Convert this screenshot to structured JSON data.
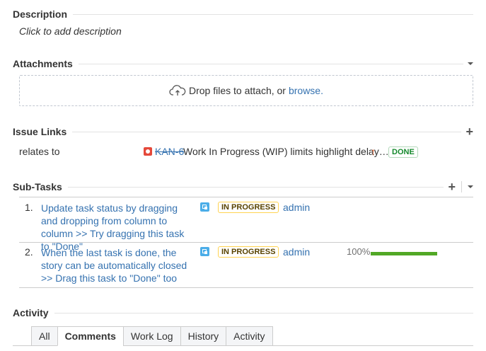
{
  "description": {
    "title": "Description",
    "placeholder": "Click to add description"
  },
  "attachments": {
    "title": "Attachments",
    "drop_text": "Drop files to attach, or",
    "browse_link": "browse."
  },
  "issue_links": {
    "title": "Issue Links",
    "links": [
      {
        "type": "relates to",
        "key": "KAN-6",
        "summary": "Work In Progress (WIP) limits highlight delay…",
        "priority_icon": "arrow-up-icon",
        "status": "DONE"
      }
    ]
  },
  "subtasks": {
    "title": "Sub-Tasks",
    "items": [
      {
        "num": "1.",
        "summary": "Update task status by dragging and dropping from column to column >> Try dragging this task to \"Done\"",
        "status": "IN PROGRESS",
        "assignee": "admin"
      },
      {
        "num": "2.",
        "summary": "When the last task is done, the story can be automatically closed >> Drag this task to \"Done\" too",
        "status": "IN PROGRESS",
        "assignee": "admin",
        "progress_label": "100%",
        "progress": 1.0
      }
    ]
  },
  "activity": {
    "title": "Activity",
    "tabs": [
      "All",
      "Comments",
      "Work Log",
      "History",
      "Activity"
    ],
    "active_tab": "Comments"
  },
  "colors": {
    "link": "#3572b0",
    "done_green": "#14892c",
    "progress_bar": "#51a825",
    "bug_red": "#e5493a",
    "priority_orange": "#f15c22"
  }
}
